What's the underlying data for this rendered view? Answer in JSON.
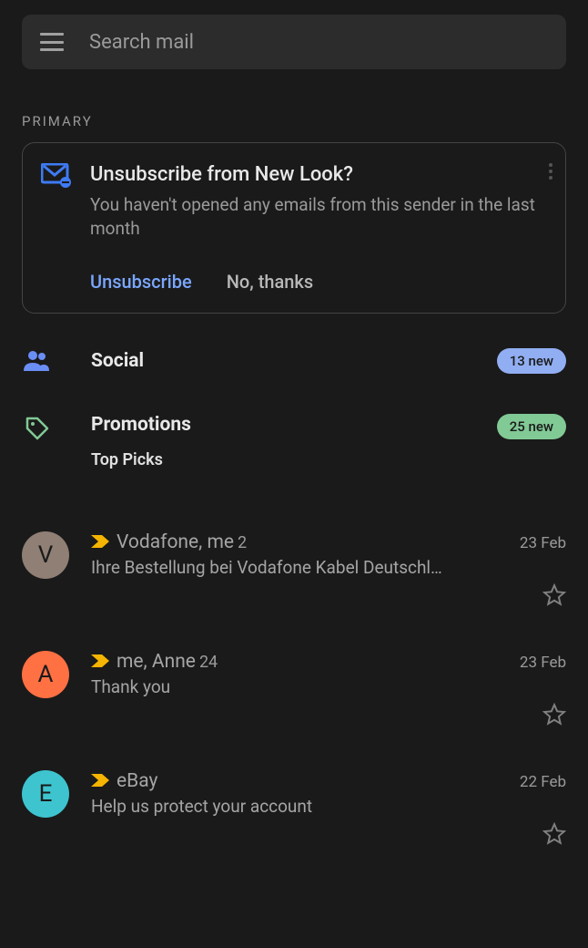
{
  "search": {
    "placeholder": "Search mail"
  },
  "section_label": "PRIMARY",
  "card": {
    "title": "Unsubscribe from New Look?",
    "body": "You haven't opened any emails from this sender in the last month",
    "action_unsubscribe": "Unsubscribe",
    "action_no": "No, thanks"
  },
  "categories": {
    "social": {
      "title": "Social",
      "badge": "13 new"
    },
    "promotions": {
      "title": "Promotions",
      "badge": "25 new",
      "sub": "Top Picks"
    }
  },
  "emails": [
    {
      "avatar_letter": "V",
      "avatar_color": "#8f7f74",
      "sender": "Vodafone, me",
      "count": "2",
      "date": "23 Feb",
      "subject": "Ihre Bestellung bei Vodafone Kabel Deutschl…"
    },
    {
      "avatar_letter": "A",
      "avatar_color": "#ff7043",
      "sender": "me, Anne",
      "count": "24",
      "date": "23 Feb",
      "subject": "Thank you"
    },
    {
      "avatar_letter": "E",
      "avatar_color": "#3dc4cf",
      "sender": "eBay",
      "count": "",
      "date": "22 Feb",
      "subject": "Help us protect your account"
    }
  ]
}
